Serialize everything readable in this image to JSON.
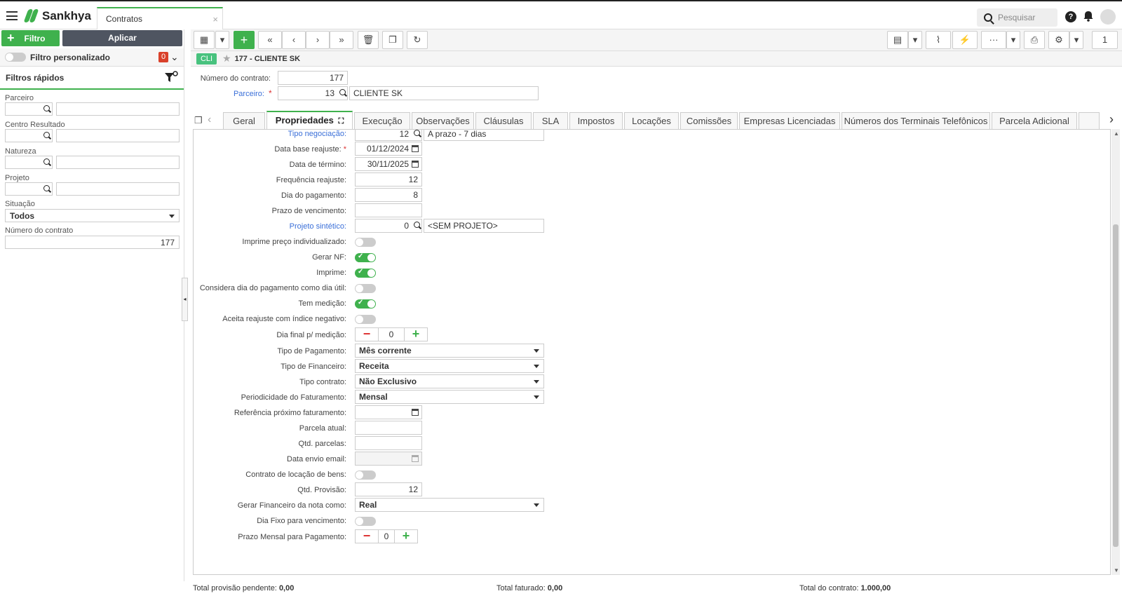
{
  "app": {
    "name": "Sankhya",
    "tab": "Contratos",
    "tab_close": "×",
    "search_placeholder": "Pesquisar",
    "page_number": "1"
  },
  "left": {
    "filtro_label": "Filtro",
    "aplicar_label": "Aplicar",
    "filtro_personalizado": "Filtro personalizado",
    "badge_count": "0",
    "filtros_rapidos": "Filtros rápidos",
    "fields": [
      "Parceiro",
      "Centro Resultado",
      "Natureza",
      "Projeto"
    ],
    "situacao_label": "Situação",
    "situacao_value": "Todos",
    "numero_label": "Número do contrato",
    "numero_value": "177"
  },
  "breadcrumb": {
    "tag": "CLI",
    "title": "177 - CLIENTE SK"
  },
  "header": {
    "numero_label": "Número do contrato:",
    "numero_value": "177",
    "parceiro_label": "Parceiro:",
    "parceiro_code": "13",
    "parceiro_name": "CLIENTE SK"
  },
  "tabs": [
    "Geral",
    "Propriedades",
    "Execução",
    "Observações",
    "Cláusulas",
    "SLA",
    "Impostos",
    "Locações",
    "Comissões",
    "Empresas Licenciadas",
    "Números dos Terminais Telefônicos",
    "Parcela Adicional"
  ],
  "form": {
    "tipo_negociacao": {
      "label": "Tipo negociação:",
      "code": "12",
      "desc": "A prazo - 7 dias"
    },
    "data_base": {
      "label": "Data base reajuste:",
      "value": "01/12/2024"
    },
    "data_termino": {
      "label": "Data de término:",
      "value": "30/11/2025"
    },
    "frequencia": {
      "label": "Frequência reajuste:",
      "value": "12"
    },
    "dia_pagamento": {
      "label": "Dia do pagamento:",
      "value": "8"
    },
    "prazo_vencimento": {
      "label": "Prazo de vencimento:",
      "value": ""
    },
    "projeto": {
      "label": "Projeto sintético:",
      "code": "0",
      "desc": "<SEM PROJETO>"
    },
    "imprime_preco": {
      "label": "Imprime preço individualizado:"
    },
    "gerar_nf": {
      "label": "Gerar NF:"
    },
    "imprime": {
      "label": "Imprime:"
    },
    "considera_dia": {
      "label": "Considera dia do pagamento como dia útil:"
    },
    "tem_medicao": {
      "label": "Tem medição:"
    },
    "aceita_reajuste": {
      "label": "Aceita reajuste com índice negativo:"
    },
    "dia_final": {
      "label": "Dia final p/ medição:",
      "value": "0"
    },
    "tipo_pagamento": {
      "label": "Tipo de Pagamento:",
      "value": "Mês corrente"
    },
    "tipo_financeiro": {
      "label": "Tipo de Financeiro:",
      "value": "Receita"
    },
    "tipo_contrato": {
      "label": "Tipo contrato:",
      "value": "Não Exclusivo"
    },
    "periodicidade": {
      "label": "Periodicidade do Faturamento:",
      "value": "Mensal"
    },
    "referencia": {
      "label": "Referência próximo faturamento:"
    },
    "parcela_atual": {
      "label": "Parcela atual:"
    },
    "qtd_parcelas": {
      "label": "Qtd. parcelas:"
    },
    "data_envio": {
      "label": "Data envio email:"
    },
    "contrato_locacao": {
      "label": "Contrato de locação de bens:"
    },
    "qtd_provisao": {
      "label": "Qtd. Provisão:",
      "value": "12"
    },
    "gerar_financeiro": {
      "label": "Gerar Financeiro da nota como:",
      "value": "Real"
    },
    "dia_fixo": {
      "label": "Dia Fixo para vencimento:"
    },
    "prazo_mensal": {
      "label": "Prazo Mensal para Pagamento:",
      "value": "0"
    }
  },
  "footer": {
    "provisao_label": "Total provisão pendente:",
    "provisao_value": "0,00",
    "faturado_label": "Total faturado:",
    "faturado_value": "0,00",
    "contrato_label": "Total do contrato:",
    "contrato_value": "1.000,00"
  },
  "colors": {
    "accent": "#3fb14d",
    "link": "#3a6fd8",
    "danger": "#d33"
  }
}
